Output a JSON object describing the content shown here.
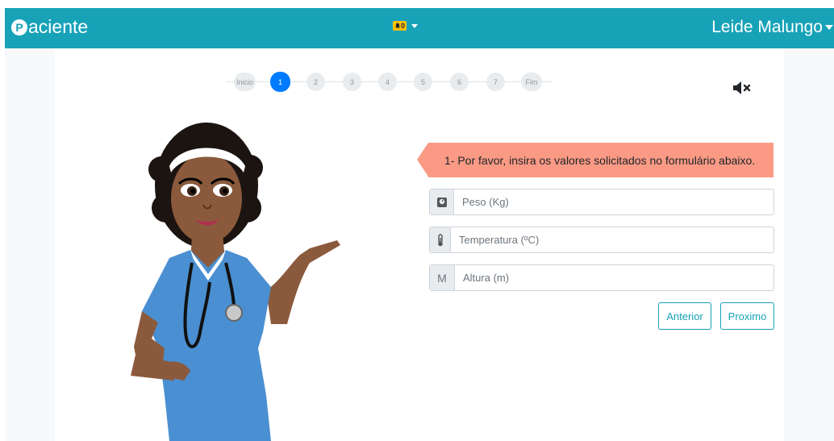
{
  "navbar": {
    "brand_letter": "P",
    "brand_text": "aciente",
    "notification_count": "0",
    "user_name": "Leide Malungo"
  },
  "wizard": {
    "steps": [
      "Inicio",
      "1",
      "2",
      "3",
      "4",
      "5",
      "6",
      "7",
      "Fim"
    ],
    "active_step": "1"
  },
  "alert": {
    "message": "1- Por favor, insira os valores solicitados no formulário abaixo."
  },
  "form": {
    "weight": {
      "addon_icon": "scale-icon",
      "placeholder": "Peso (Kg)",
      "value": ""
    },
    "temperature": {
      "addon_icon": "thermometer-icon",
      "placeholder": "Temperatura (ºC)",
      "value": ""
    },
    "height": {
      "addon_text": "M",
      "placeholder": "Altura (m)",
      "value": ""
    }
  },
  "buttons": {
    "previous_label": "Anterior",
    "next_label": "Proximo"
  },
  "icons": {
    "sound": "volume-mute-icon",
    "nurse": "nurse-illustration"
  },
  "colors": {
    "navbar": "#17a2b8",
    "active_step": "#007bff",
    "alert": "#fa9a85",
    "badge": "#ffc107"
  }
}
